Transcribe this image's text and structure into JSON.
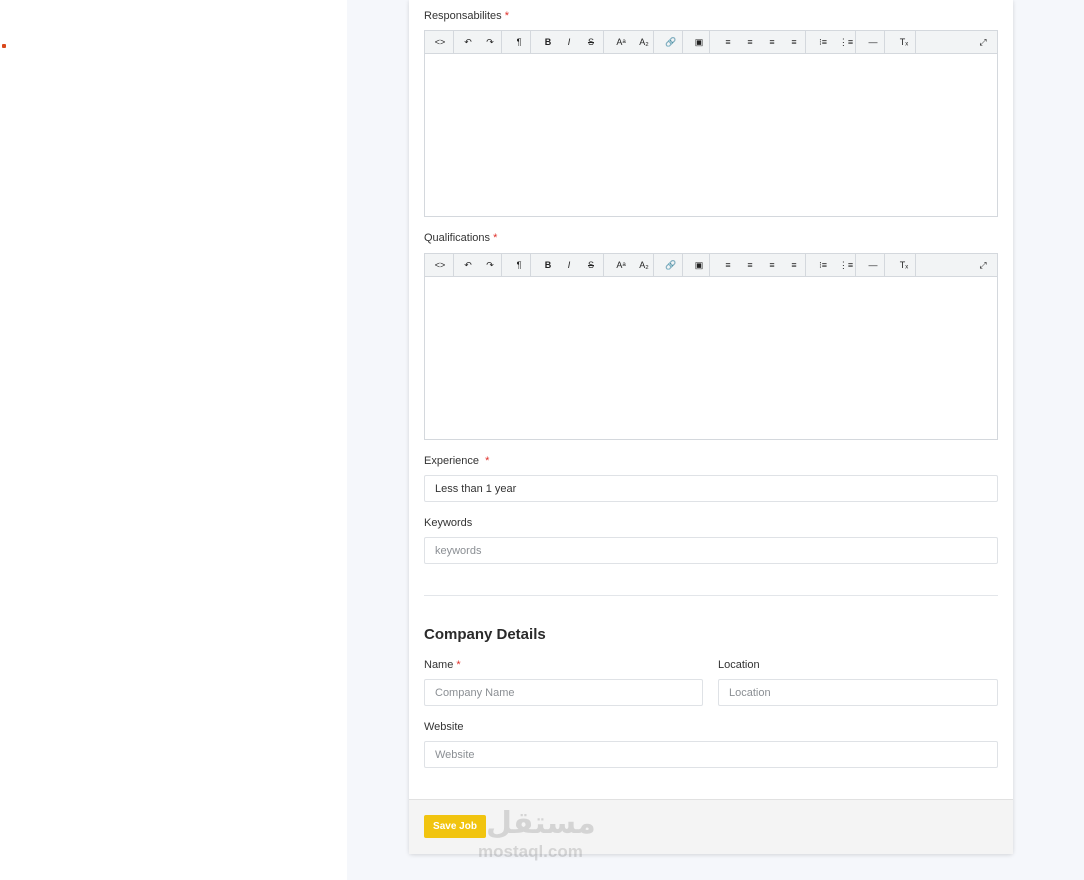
{
  "responsibilities": {
    "label": "Responsabilites",
    "required": "*"
  },
  "qualifications": {
    "label": "Qualifications",
    "required": "*"
  },
  "editor_toolbar": [
    {
      "name": "code-view-icon",
      "glyph": "<>"
    },
    {
      "name": "undo-icon",
      "glyph": "↶"
    },
    {
      "name": "redo-icon",
      "glyph": "↷"
    },
    {
      "name": "paragraph-icon",
      "glyph": "¶"
    },
    {
      "name": "bold-icon",
      "glyph": "B"
    },
    {
      "name": "italic-icon",
      "glyph": "I"
    },
    {
      "name": "strikethrough-icon",
      "glyph": "S"
    },
    {
      "name": "superscript-icon",
      "glyph": "Aᵃ"
    },
    {
      "name": "subscript-icon",
      "glyph": "A₂"
    },
    {
      "name": "link-icon",
      "glyph": "🔗"
    },
    {
      "name": "image-icon",
      "glyph": "▣"
    },
    {
      "name": "align-left-icon",
      "glyph": "≡"
    },
    {
      "name": "align-center-icon",
      "glyph": "≡"
    },
    {
      "name": "align-right-icon",
      "glyph": "≡"
    },
    {
      "name": "align-justify-icon",
      "glyph": "≡"
    },
    {
      "name": "bullet-list-icon",
      "glyph": "⁝≡"
    },
    {
      "name": "numbered-list-icon",
      "glyph": "⋮≡"
    },
    {
      "name": "horizontal-rule-icon",
      "glyph": "—"
    },
    {
      "name": "clear-format-icon",
      "glyph": "Tₓ"
    },
    {
      "name": "fullscreen-icon",
      "glyph": "⤢"
    }
  ],
  "experience": {
    "label": "Experience",
    "required": "*",
    "value": "Less than 1 year"
  },
  "keywords": {
    "label": "Keywords",
    "placeholder": "keywords"
  },
  "company": {
    "title": "Company Details",
    "name_label": "Name",
    "name_required": "*",
    "name_placeholder": "Company Name",
    "location_label": "Location",
    "location_placeholder": "Location",
    "website_label": "Website",
    "website_placeholder": "Website"
  },
  "actions": {
    "save_label": "Save Job"
  },
  "watermark": {
    "arabic": "مستقل",
    "latin": "mostaql.com"
  },
  "colors": {
    "accent": "#f1c40f",
    "required": "#e0302a",
    "panel_bg": "#f5f7fb"
  }
}
